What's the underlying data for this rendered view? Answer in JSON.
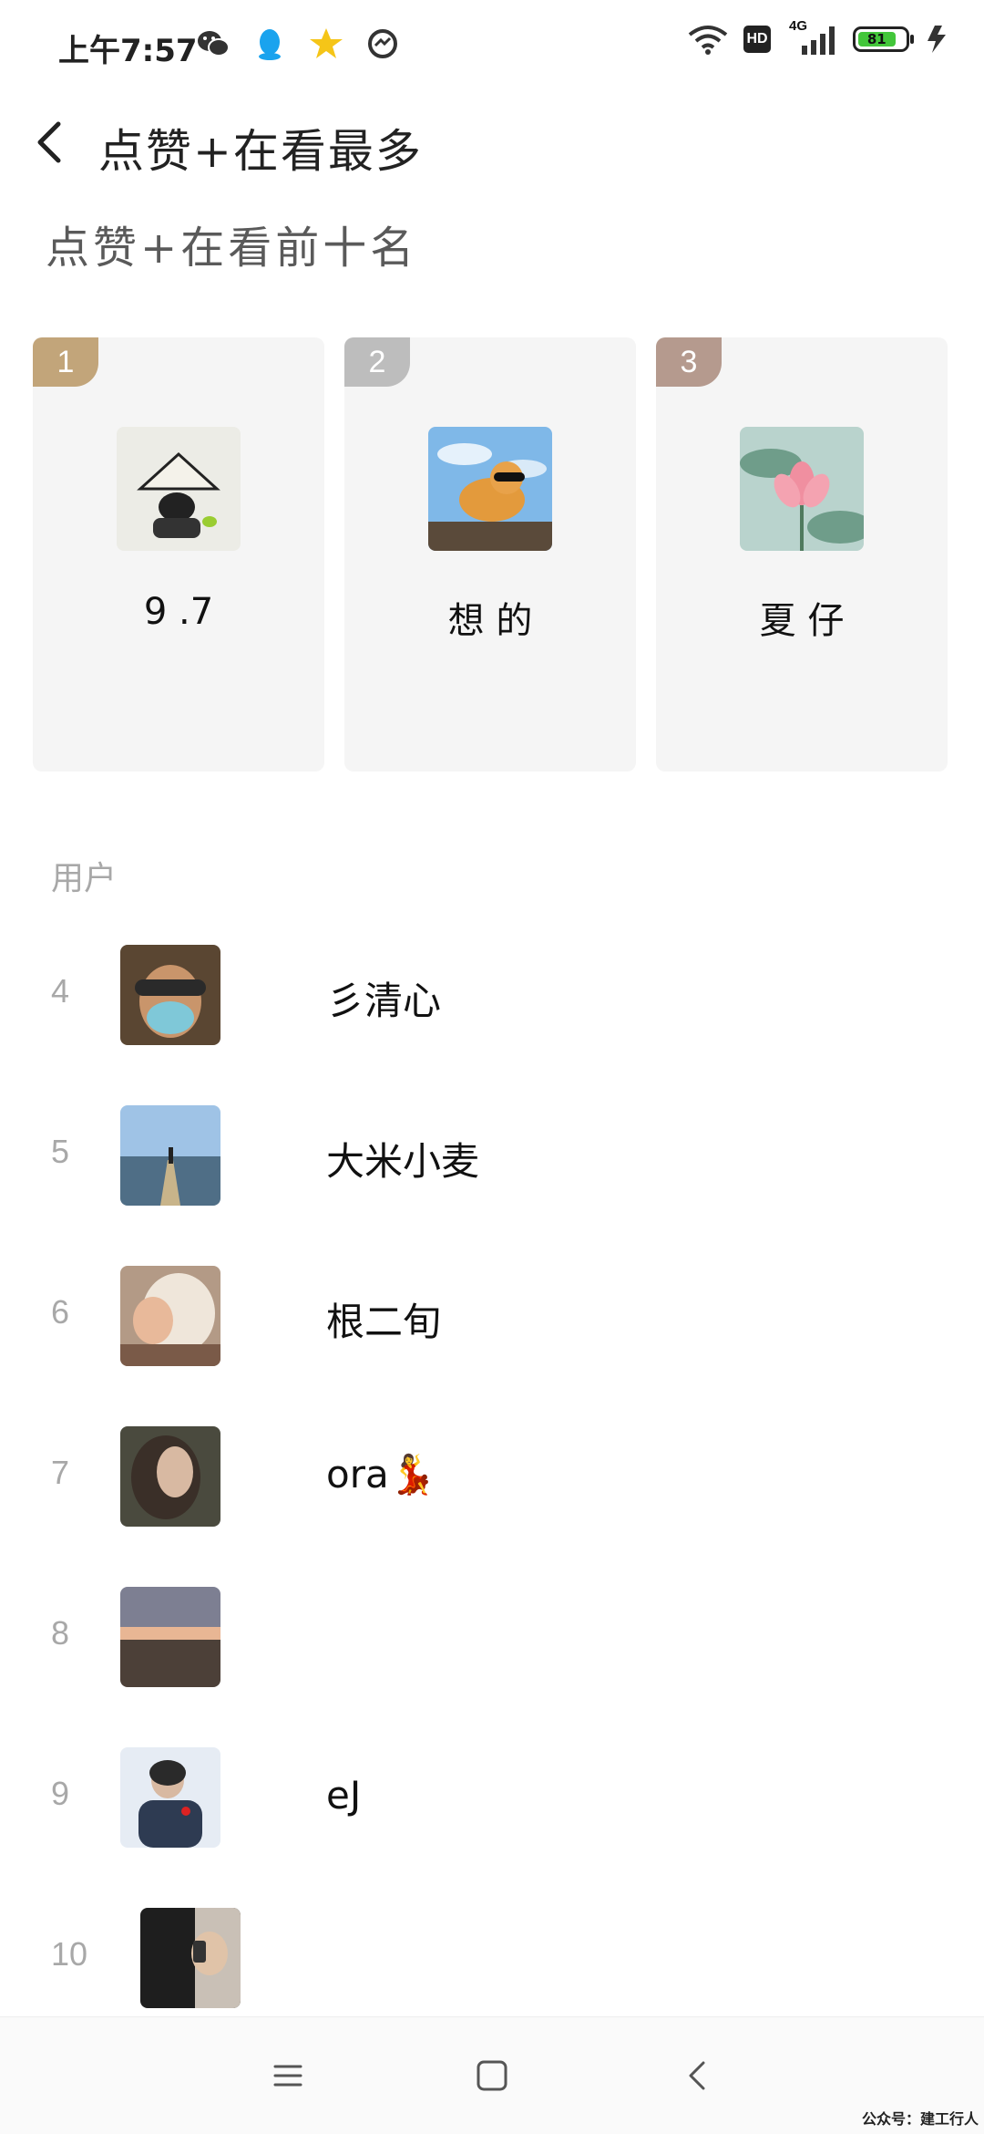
{
  "status_bar": {
    "time": "上午7:57",
    "network_label": "4G",
    "hd_label": "HD",
    "battery_percent": "81"
  },
  "header": {
    "title": "点赞+在看最多"
  },
  "top_section": {
    "title": "点赞+在看前十名",
    "podium": [
      {
        "rank": "1",
        "name": "9   .7",
        "badge_color": "#c2a57a"
      },
      {
        "rank": "2",
        "name": "想         的",
        "badge_color": "#bdbdbd"
      },
      {
        "rank": "3",
        "name": "夏       仔",
        "badge_color": "#b59a8e"
      }
    ]
  },
  "users_section": {
    "label": "用户",
    "rows": [
      {
        "rank": "4",
        "name": "彡清心"
      },
      {
        "rank": "5",
        "name": "大米小麦"
      },
      {
        "rank": "6",
        "name": "根二旬"
      },
      {
        "rank": "7",
        "name": "ora💃"
      },
      {
        "rank": "8",
        "name": ""
      },
      {
        "rank": "9",
        "name": "eJ"
      },
      {
        "rank": "10",
        "name": ""
      }
    ]
  },
  "watermark": "公众号：建工行人",
  "colors": {
    "accent_gold": "#c2a57a",
    "accent_silver": "#bdbdbd",
    "accent_bronze": "#b59a8e",
    "muted_text": "#a8a8a8"
  }
}
